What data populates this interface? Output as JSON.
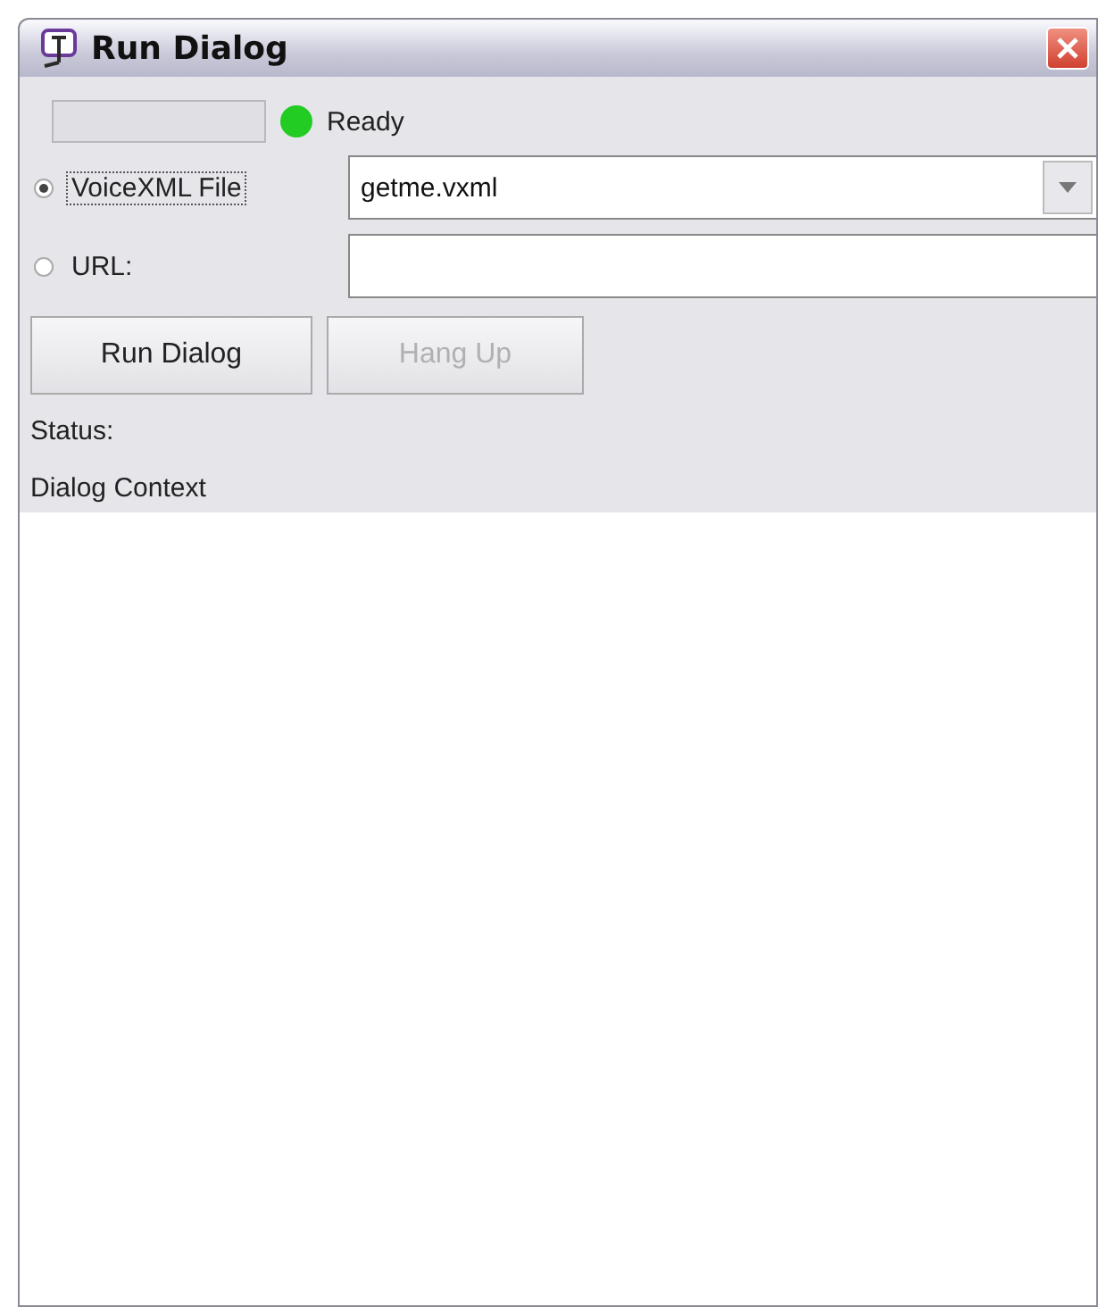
{
  "window": {
    "title": "Run Dialog"
  },
  "status": {
    "kind": "ready",
    "text": "Ready"
  },
  "sources": [
    {
      "label": "VoiceXML File",
      "selected": true,
      "kind": "dropdown",
      "value": "getme.vxml"
    },
    {
      "label": "URL:",
      "selected": false,
      "kind": "text"
    }
  ],
  "buttons": [
    {
      "label": "Run Dialog",
      "disabled": false
    },
    {
      "label": "Hang Up",
      "disabled": true
    }
  ],
  "status_label": "Status:",
  "context_label": "Dialog Context"
}
